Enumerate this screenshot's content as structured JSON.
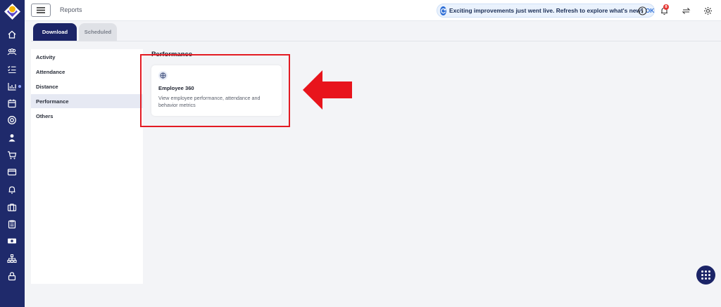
{
  "header": {
    "breadcrumb": "Reports",
    "notice_text": "Exciting improvements just went live. Refresh to explore what's new!",
    "notice_action": "OK",
    "notification_count": "8"
  },
  "tabs": [
    {
      "label": "Download",
      "active": true
    },
    {
      "label": "Scheduled",
      "active": false
    }
  ],
  "subnav": [
    {
      "label": "Activity"
    },
    {
      "label": "Attendance"
    },
    {
      "label": "Distance"
    },
    {
      "label": "Performance",
      "active": true
    },
    {
      "label": "Others"
    }
  ],
  "main": {
    "section_title": "Performance",
    "cards": [
      {
        "title": "Employee 360",
        "description": "View employee performance, attendance and behavior metrics",
        "icon": "globe-icon"
      }
    ]
  },
  "sidebar_icons": [
    "home-icon",
    "team-icon",
    "checklist-icon",
    "chart-icon",
    "calendar-icon",
    "target-icon",
    "person-icon",
    "cart-icon",
    "card-icon",
    "bell-icon",
    "briefcase-icon",
    "clipboard-icon",
    "money-icon",
    "org-chart-icon",
    "lock-icon"
  ],
  "colors": {
    "rail": "#1f2a6b",
    "accent": "#1b2467",
    "highlight": "#e31b23",
    "link": "#2f6fd6"
  }
}
